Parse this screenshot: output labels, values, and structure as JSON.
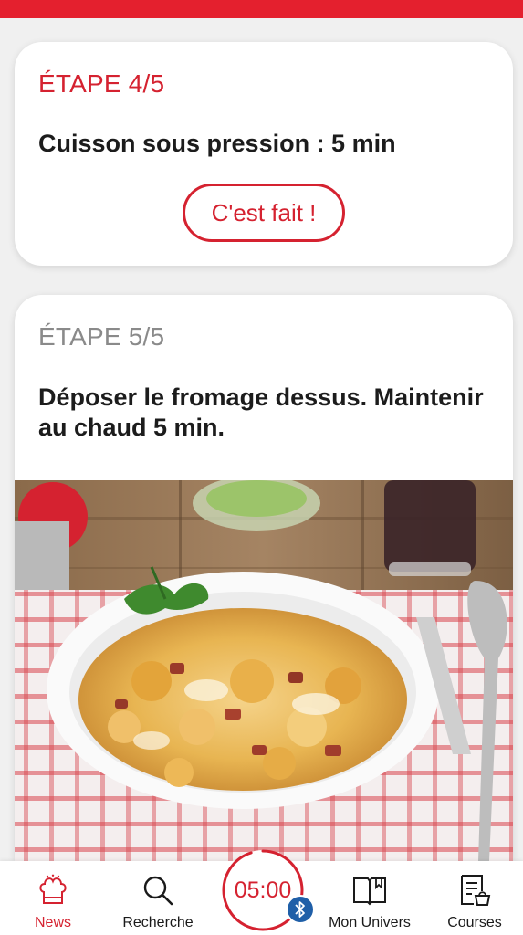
{
  "colors": {
    "brand_red": "#e4202e",
    "accent_red": "#d52230",
    "inactive_gray": "#8a8a8a",
    "bluetooth_blue": "#1f5fa8"
  },
  "step_current": {
    "label": "ÉTAPE 4/5",
    "text": "Cuisson sous pression : 5 min",
    "done_button": "C'est fait !"
  },
  "step_next": {
    "label": "ÉTAPE 5/5",
    "text": "Déposer le fromage dessus. Maintenir au chaud 5 min.",
    "image": "gratin-potatoes-photo"
  },
  "nav": {
    "items": [
      {
        "label": "News",
        "icon": "chef-hat-icon",
        "active": true
      },
      {
        "label": "Recherche",
        "icon": "search-icon",
        "active": false
      },
      {
        "label": "Mon Univers",
        "icon": "book-icon",
        "active": false
      },
      {
        "label": "Courses",
        "icon": "shopping-list-icon",
        "active": false
      }
    ],
    "timer": {
      "value": "05:00",
      "icon": "bluetooth-icon",
      "progress": 0.95
    }
  }
}
